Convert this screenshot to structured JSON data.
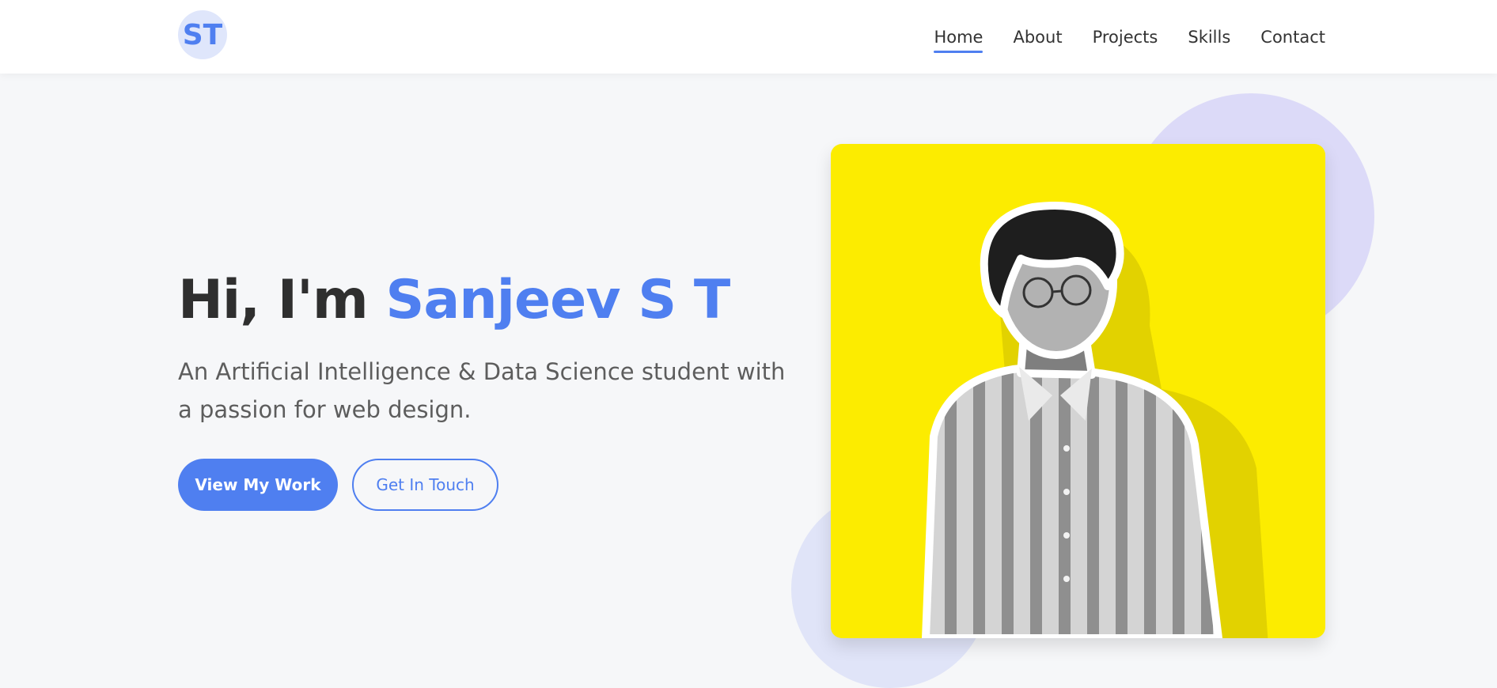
{
  "logo": {
    "initials": "ST"
  },
  "nav": {
    "items": [
      {
        "label": "Home",
        "active": true
      },
      {
        "label": "About",
        "active": false
      },
      {
        "label": "Projects",
        "active": false
      },
      {
        "label": "Skills",
        "active": false
      },
      {
        "label": "Contact",
        "active": false
      }
    ]
  },
  "hero": {
    "greeting": "Hi, I'm ",
    "name": "Sanjeev S T",
    "subtitle": "An Artificial Intelligence & Data Science student with a passion for web design.",
    "primary_button": "View My Work",
    "secondary_button": "Get In Touch"
  },
  "portrait": {
    "icon": "person-photo",
    "background_color": "#fcec00"
  },
  "colors": {
    "accent": "#4f7ff0",
    "text_dark": "#2f2f2f",
    "text_muted": "#5d5d5d",
    "page_bg": "#f6f7f9",
    "circle_top": "#dcdaf8",
    "circle_bottom": "#e0e4f8"
  }
}
